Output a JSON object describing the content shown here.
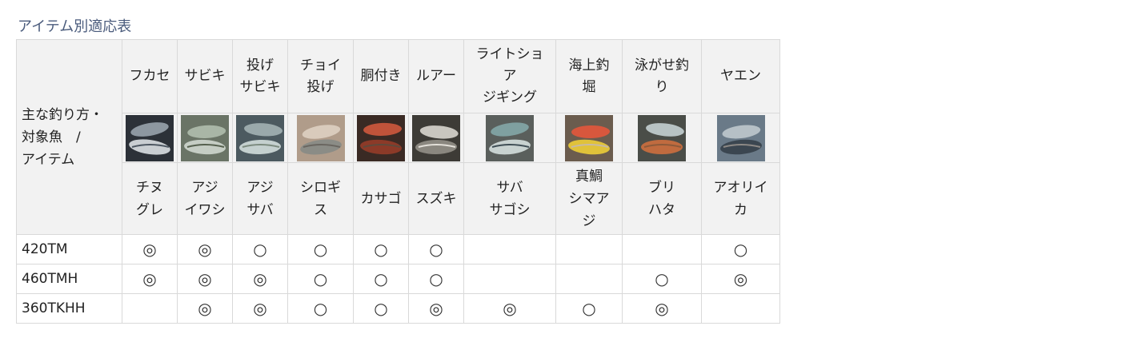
{
  "title": "アイテム別適応表",
  "corner_label": "主な釣り方・\n対象魚　/\nアイテム",
  "methods": [
    {
      "label": "フカセ",
      "fish": "チヌ\nグレ",
      "image": "fish-photo-chinu-gure",
      "palette": [
        "#2c3138",
        "#8d97a0",
        "#c9ced2",
        "#4b5560"
      ]
    },
    {
      "label": "サビキ",
      "fish": "アジ\nイワシ",
      "image": "fish-photo-aji-iwashi",
      "palette": [
        "#6a7466",
        "#a9b6a6",
        "#c5cdc4",
        "#55604e"
      ]
    },
    {
      "label": "投げ\nサビキ",
      "fish": "アジ\nサバ",
      "image": "fish-photo-aji-saba",
      "palette": [
        "#4c5a60",
        "#9aa9ab",
        "#c4d0cf",
        "#7b8a7e"
      ]
    },
    {
      "label": "チョイ\n投げ",
      "fish": "シロギ\nス",
      "image": "fish-photo-shirogisu",
      "palette": [
        "#b09c8a",
        "#d9cbbc",
        "#8b8c86",
        "#6a6660"
      ]
    },
    {
      "label": "胴付き",
      "fish": "カサゴ",
      "image": "fish-photo-kasago",
      "palette": [
        "#3a2a24",
        "#c0533a",
        "#8c3a28",
        "#5d4a3c"
      ]
    },
    {
      "label": "ルアー",
      "fish": "スズキ",
      "image": "fish-photo-suzuki",
      "palette": [
        "#3d3b36",
        "#c9c6bf",
        "#8a877f",
        "#e4e1da"
      ]
    },
    {
      "label": "ライトショ\nア\nジギング",
      "fish": "サバ\nサゴシ",
      "image": "fish-photo-saba-sagoshi",
      "palette": [
        "#5a5f5c",
        "#7fa0a0",
        "#c8d2d0",
        "#3f4e55"
      ]
    },
    {
      "label": "海上釣\n堀",
      "fish": "真鯛\nシマア\nジ",
      "image": "fish-photo-madai-shimaaji",
      "palette": [
        "#6b5c4e",
        "#d8573d",
        "#e0c23a",
        "#c7b9a6"
      ]
    },
    {
      "label": "泳がせ釣\nり",
      "fish": "ブリ\nハタ",
      "image": "fish-photo-buri-hata",
      "palette": [
        "#4a4d48",
        "#b8c3c4",
        "#c06b3f",
        "#8c5a3a"
      ]
    },
    {
      "label": "ヤエン",
      "fish": "アオリイ\nカ",
      "image": "fish-photo-aoriika",
      "palette": [
        "#6a7a88",
        "#b6c0c6",
        "#3b4650",
        "#8e8a86"
      ]
    }
  ],
  "items": [
    {
      "name": "420TM",
      "marks": [
        "◎",
        "◎",
        "○",
        "○",
        "○",
        "○",
        "",
        "",
        "",
        "○"
      ]
    },
    {
      "name": "460TMH",
      "marks": [
        "◎",
        "◎",
        "◎",
        "○",
        "○",
        "○",
        "",
        "",
        "○",
        "◎"
      ]
    },
    {
      "name": "360TKHH",
      "marks": [
        "",
        "◎",
        "◎",
        "○",
        "○",
        "◎",
        "◎",
        "○",
        "◎",
        ""
      ]
    }
  ]
}
